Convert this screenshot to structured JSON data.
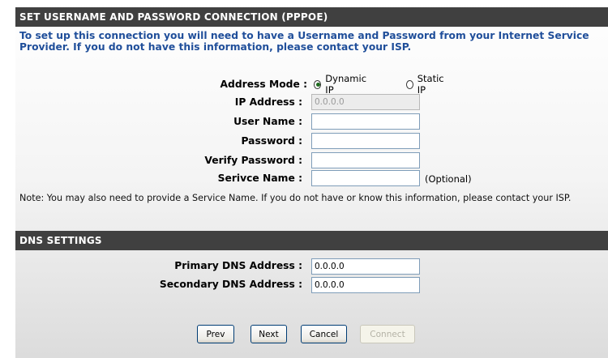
{
  "pppoe": {
    "header": "SET USERNAME AND PASSWORD CONNECTION (PPPOE)",
    "intro": "To set up this connection you will need to have a Username and Password from your Internet Service Provider. If you do not have this information, please contact your ISP.",
    "address_mode_label": "Address Mode :",
    "address_mode_options": [
      "Dynamic IP",
      "Static IP"
    ],
    "address_mode_selected": "Dynamic IP",
    "ip_address_label": "IP Address :",
    "ip_address_value": "0.0.0.0",
    "user_name_label": "User Name :",
    "user_name_value": "",
    "password_label": "Password :",
    "password_value": "",
    "verify_password_label": "Verify Password :",
    "verify_password_value": "",
    "service_name_label": "Serivce Name :",
    "service_name_value": "",
    "service_name_hint": "(Optional)",
    "note": "Note: You may also need to provide a Service Name. If you do not have or know this information, please contact your ISP."
  },
  "dns": {
    "header": "DNS SETTINGS",
    "primary_label": "Primary DNS Address :",
    "primary_value": "0.0.0.0",
    "secondary_label": "Secondary DNS Address :",
    "secondary_value": "0.0.0.0"
  },
  "buttons": {
    "prev": "Prev",
    "next": "Next",
    "cancel": "Cancel",
    "connect": "Connect"
  },
  "colors": {
    "section_header_bg": "#404040",
    "intro_text": "#1f4e9a"
  }
}
